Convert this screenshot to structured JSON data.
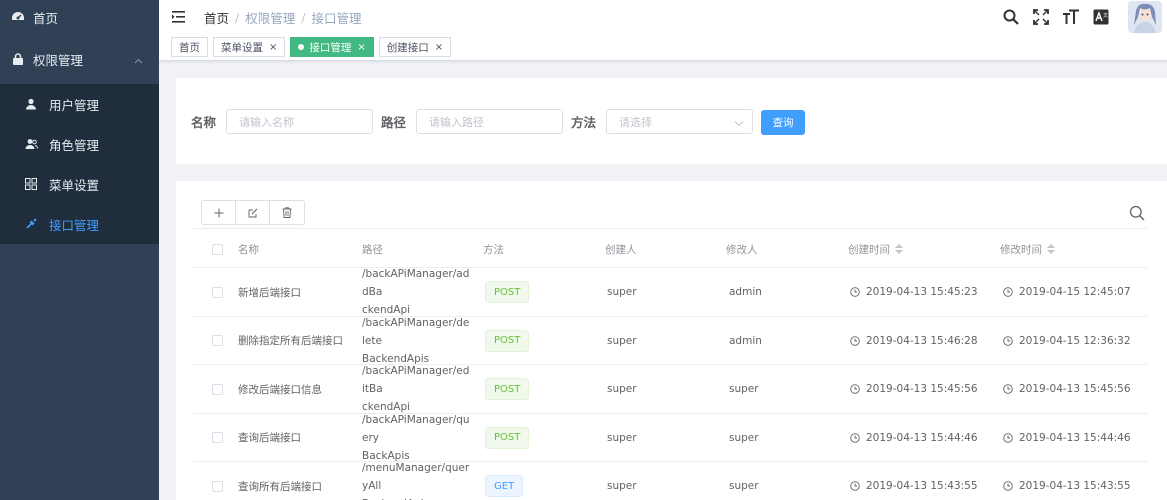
{
  "sidebar": {
    "home": {
      "label": "首页",
      "icon": "dashboard-icon"
    },
    "group": {
      "label": "权限管理",
      "icon": "lock-icon"
    },
    "items": [
      {
        "label": "用户管理",
        "icon": "user-icon"
      },
      {
        "label": "角色管理",
        "icon": "people-icon"
      },
      {
        "label": "菜单设置",
        "icon": "grid-icon"
      },
      {
        "label": "接口管理",
        "icon": "link-icon",
        "active": true
      }
    ]
  },
  "header": {
    "breadcrumb": [
      "首页",
      "权限管理",
      "接口管理"
    ],
    "icons": [
      "search-icon",
      "fullscreen-icon",
      "font-size-icon",
      "translate-icon"
    ]
  },
  "tags": [
    {
      "label": "首页",
      "closable": false
    },
    {
      "label": "菜单设置",
      "closable": true
    },
    {
      "label": "接口管理",
      "closable": true,
      "active": true
    },
    {
      "label": "创建接口",
      "closable": true
    }
  ],
  "search": {
    "name_label": "名称",
    "name_placeholder": "请输入名称",
    "path_label": "路径",
    "path_placeholder": "请输入路径",
    "method_label": "方法",
    "method_placeholder": "请选择",
    "query_button": "查询"
  },
  "table": {
    "columns": [
      "名称",
      "路径",
      "方法",
      "创建人",
      "修改人",
      "创建时间",
      "修改时间"
    ],
    "rows": [
      {
        "name": "新增后端接口",
        "path1": "/backAPiManager/addBa",
        "path2": "ckendApi",
        "method": "POST",
        "creator": "super",
        "modifier": "admin",
        "created": "2019-04-13 15:45:23",
        "modified": "2019-04-15 12:45:07"
      },
      {
        "name": "删除指定所有后端接口",
        "path1": "/backAPiManager/delete",
        "path2": "BackendApis",
        "method": "POST",
        "creator": "super",
        "modifier": "admin",
        "created": "2019-04-13 15:46:28",
        "modified": "2019-04-15 12:36:32"
      },
      {
        "name": "修改后端接口信息",
        "path1": "/backAPiManager/editBa",
        "path2": "ckendApi",
        "method": "POST",
        "creator": "super",
        "modifier": "super",
        "created": "2019-04-13 15:45:56",
        "modified": "2019-04-13 15:45:56"
      },
      {
        "name": "查询后端接口",
        "path1": "/backAPiManager/query",
        "path2": "BackApis",
        "method": "POST",
        "creator": "super",
        "modifier": "super",
        "created": "2019-04-13 15:44:46",
        "modified": "2019-04-13 15:44:46"
      },
      {
        "name": "查询所有后端接口",
        "path1": "/menuManager/queryAll",
        "path2": "BackendApi",
        "method": "GET",
        "creator": "super",
        "modifier": "super",
        "created": "2019-04-13 15:43:55",
        "modified": "2019-04-13 15:43:55"
      }
    ]
  },
  "colors": {
    "sidebar_bg": "#304156",
    "submenu_bg": "#1f2d3d",
    "accent": "#409eff",
    "tag_active": "#42b983"
  }
}
